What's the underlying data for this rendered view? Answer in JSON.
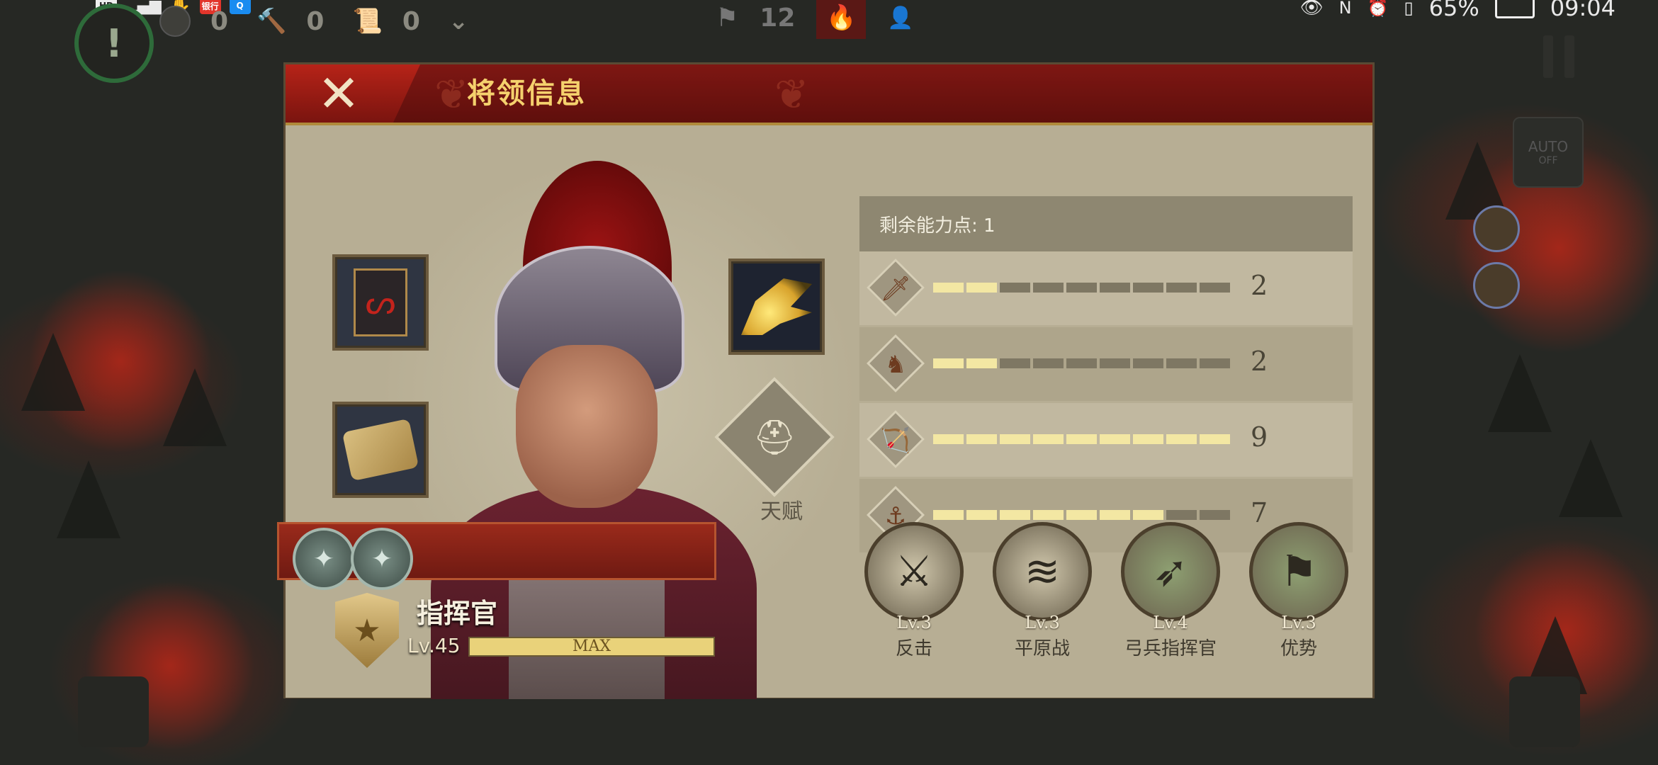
{
  "status_bar": {
    "left_labels": [
      "HD",
      "银行"
    ],
    "battery": "65%",
    "time": "09:04"
  },
  "hud": {
    "alert": "!",
    "counters": [
      "0",
      "0",
      "0"
    ],
    "center_count": "12",
    "auto_label": "AUTO",
    "auto_sub": "OFF"
  },
  "dialog": {
    "title": "将领信息",
    "close_glyph": "✕",
    "talent_label": "天赋",
    "remaining_points": "剩余能力点: 1",
    "stats": [
      {
        "icon": "sword-icon",
        "glyph": "🗡",
        "value": 2,
        "max": 9,
        "display": "2"
      },
      {
        "icon": "horse-icon",
        "glyph": "♞",
        "value": 2,
        "max": 9,
        "display": "2"
      },
      {
        "icon": "bow-icon",
        "glyph": "🏹",
        "value": 9,
        "max": 9,
        "display": "9"
      },
      {
        "icon": "anchor-icon",
        "glyph": "⚓",
        "value": 7,
        "max": 9,
        "display": "7"
      }
    ],
    "skills": [
      {
        "icon": "counterattack-icon",
        "glyph": "⚔",
        "level": "Lv.3",
        "name": "反击",
        "color": "#d1c8ad"
      },
      {
        "icon": "plains-battle-icon",
        "glyph": "≋",
        "level": "Lv.3",
        "name": "平原战",
        "color": "#d1c8ad"
      },
      {
        "icon": "archer-commander-icon",
        "glyph": "➶",
        "level": "Lv.4",
        "name": "弓兵指挥官",
        "color": "#8ea072"
      },
      {
        "icon": "advantage-icon",
        "glyph": "⚑",
        "level": "Lv.3",
        "name": "优势",
        "color": "#8ea072"
      }
    ],
    "general": {
      "rank_title": "指挥官",
      "level": "Lv.45",
      "xp_label": "MAX",
      "xp_fraction": 1.0
    }
  },
  "colors": {
    "header": "#7e1713",
    "title_gold": "#f5d16d",
    "panel": "#bdb49b",
    "pip_on": "#f3e7a3",
    "pip_off": "#7e7763"
  }
}
